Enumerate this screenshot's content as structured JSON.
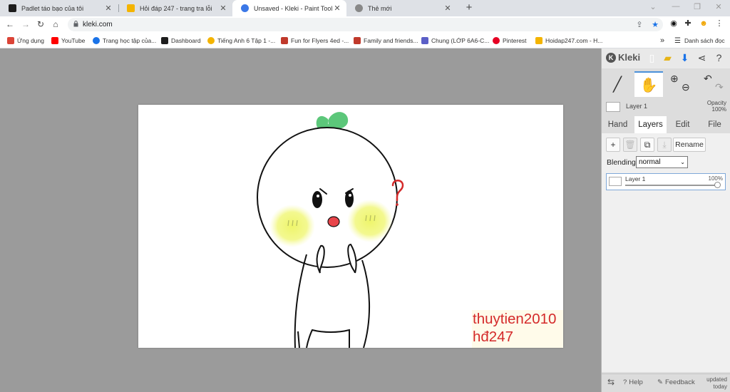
{
  "browser": {
    "tabs": [
      {
        "label": "Padlet táo bạo của tôi",
        "favicon_color": "#1d1d1d"
      },
      {
        "label": "Hỏi đáp 247 - trang tra lỗi",
        "favicon_color": "#f4b400"
      },
      {
        "label": "Unsaved - Kleki - Paint Tool",
        "favicon_color": "#3b78e7",
        "active": true
      },
      {
        "label": "Thẻ mới",
        "favicon_color": "#888888"
      }
    ],
    "new_tab_icon": "+",
    "url": "kleki.com",
    "bookmarks": [
      {
        "label": "Ứng dụng",
        "icon_color": "#db4437"
      },
      {
        "label": "YouTube",
        "icon_color": "#ff0000"
      },
      {
        "label": "Trang học tập của...",
        "icon_color": "#1a73e8"
      },
      {
        "label": "Dashboard",
        "icon_color": "#1d1d1d"
      },
      {
        "label": "Tiếng Anh 6 Tập 1 -...",
        "icon_color": "#f4b400"
      },
      {
        "label": "Fun for Flyers 4ed -...",
        "icon_color": "#c0392b"
      },
      {
        "label": "Family and friends...",
        "icon_color": "#c0392b"
      },
      {
        "label": "Chung (LỚP 6A6-C...",
        "icon_color": "#5b5fc7"
      },
      {
        "label": "Pinterest",
        "icon_color": "#e60023"
      },
      {
        "label": "Hoidap247.com - H...",
        "icon_color": "#f4b400"
      }
    ],
    "bookmarks_more": "»",
    "reading_list": "Danh sách đọc"
  },
  "canvas": {
    "text_line1": "thuytien2010",
    "text_line2": "hđ247",
    "text_color": "#d42a2a",
    "drawing_glyphs": {
      "question": "?",
      "blush": "ııı"
    }
  },
  "panel": {
    "logo": "Kleki",
    "layer_preview_name": "Layer 1",
    "opacity_label": "Opacity",
    "opacity_value": "100%",
    "tabs": [
      "Hand",
      "Layers",
      "Edit",
      "File"
    ],
    "active_tab": "Layers",
    "rename_label": "Rename",
    "blending_label": "Blending",
    "blending_value": "normal",
    "layer_name": "Layer 1",
    "layer_opacity": "100%",
    "footer": {
      "help": "Help",
      "feedback": "Feedback",
      "updated_line1": "updated",
      "updated_line2": "today"
    }
  },
  "colors": {
    "workspace_bg": "#9b9b9b",
    "panel_bg": "#dddddd",
    "sprout": "#5cc77a",
    "blush": "#eef56a",
    "mouth": "#e8454a"
  }
}
